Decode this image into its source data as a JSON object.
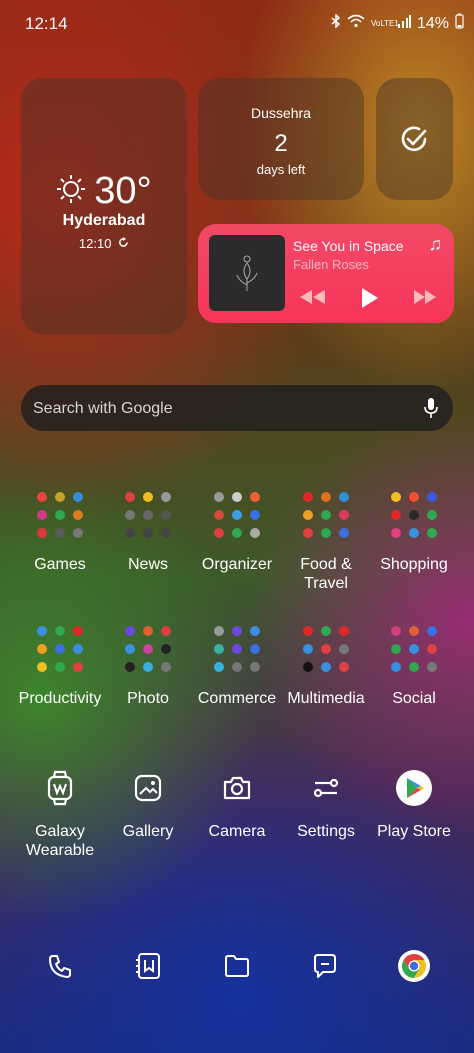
{
  "status_bar": {
    "time": "12:14",
    "network": "VoLTE1",
    "battery": "14%"
  },
  "weather": {
    "temp": "30°",
    "city": "Hyderabad",
    "time": "12:10"
  },
  "countdown": {
    "event": "Dussehra",
    "days": "2",
    "suffix": "days left"
  },
  "music": {
    "song": "See You in Space",
    "artist": "Fallen Roses"
  },
  "search": {
    "placeholder": "Search with Google"
  },
  "folders_row1": [
    {
      "label": "Games",
      "colors": [
        "#e8443a",
        "#c9a227",
        "#2f8fd8",
        "#d13a8a",
        "#2fa84f",
        "#e07a20",
        "#d93a3a",
        "#5a5a5a",
        "#777"
      ]
    },
    {
      "label": "News",
      "colors": [
        "#e04040",
        "#f0c020",
        "#999",
        "#777",
        "#666",
        "#555",
        "#444",
        "#444",
        "#444"
      ]
    },
    {
      "label": "Organizer",
      "colors": [
        "#999",
        "#ccc",
        "#f06030",
        "#d24a3a",
        "#3aa0e0",
        "#3a70e0",
        "#e04040",
        "#2fa84f",
        "#aaa"
      ]
    },
    {
      "label": "Food &\nTravel",
      "colors": [
        "#e02828",
        "#e07020",
        "#2f8fd8",
        "#f0a020",
        "#2fa84f",
        "#e03a5a",
        "#e04040",
        "#2fa84f",
        "#3a70e0"
      ]
    },
    {
      "label": "Shopping",
      "colors": [
        "#f0c020",
        "#f05030",
        "#3a5ae0",
        "#e02828",
        "#2a2a2a",
        "#2fa84f",
        "#e04080",
        "#3a90e0",
        "#2fa84f"
      ]
    }
  ],
  "folders_row2": [
    {
      "label": "Productivity",
      "colors": [
        "#3a90e0",
        "#2fa84f",
        "#e02828",
        "#f0a020",
        "#3a70e0",
        "#3a90e0",
        "#f0c020",
        "#2fa84f",
        "#e04040"
      ]
    },
    {
      "label": "Photo",
      "colors": [
        "#6a4ae0",
        "#e06030",
        "#e04040",
        "#3a90e0",
        "#d040a0",
        "#222",
        "#222",
        "#3ab0e0",
        "#777"
      ]
    },
    {
      "label": "Commerce",
      "colors": [
        "#999",
        "#6a4ae0",
        "#3a90e0",
        "#3ab0a0",
        "#6a4ae0",
        "#3a70e0",
        "#3ab0e0",
        "#777",
        "#777"
      ]
    },
    {
      "label": "Multimedia",
      "colors": [
        "#e02828",
        "#2fa84f",
        "#e02828",
        "#3a90e0",
        "#e04040",
        "#777",
        "#111",
        "#3a90e0",
        "#e04040"
      ]
    },
    {
      "label": "Social",
      "colors": [
        "#d04080",
        "#e06030",
        "#3a70e0",
        "#2fa84f",
        "#3a90e0",
        "#e04040",
        "#3a90e0",
        "#2fa84f",
        "#777"
      ]
    }
  ],
  "apps": [
    {
      "label": "Galaxy\nWearable",
      "icon": "wearable-icon"
    },
    {
      "label": "Gallery",
      "icon": "gallery-icon"
    },
    {
      "label": "Camera",
      "icon": "camera-icon"
    },
    {
      "label": "Settings",
      "icon": "settings-icon"
    },
    {
      "label": "Play Store",
      "icon": "play-store-icon"
    }
  ],
  "dock": [
    "phone-icon",
    "notes-icon",
    "files-icon",
    "messages-icon",
    "chrome-icon"
  ]
}
